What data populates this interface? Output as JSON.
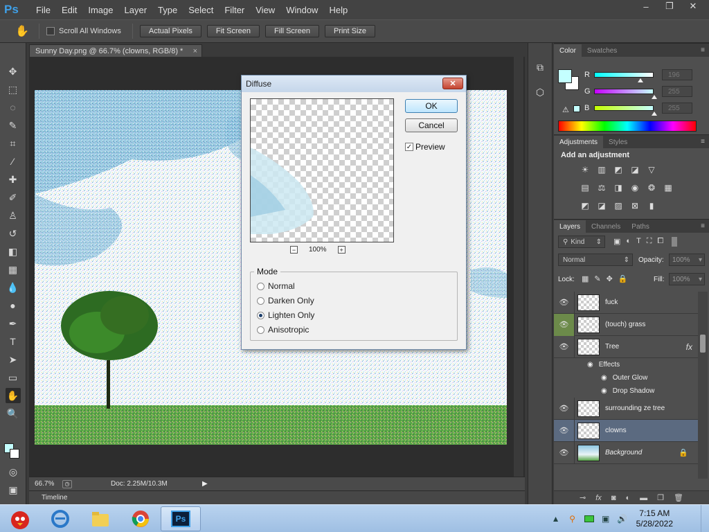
{
  "app": {
    "logo": "Ps",
    "menu": [
      "File",
      "Edit",
      "Image",
      "Layer",
      "Type",
      "Select",
      "Filter",
      "View",
      "Window",
      "Help"
    ],
    "window_controls": [
      "–",
      "❐",
      "✕"
    ]
  },
  "options_bar": {
    "scroll_all_label": "Scroll All Windows",
    "buttons": [
      "Actual Pixels",
      "Fit Screen",
      "Fill Screen",
      "Print Size"
    ]
  },
  "document": {
    "tab_title": "Sunny Day.png @ 66.7% (clowns, RGB/8) *",
    "tab_close": "×",
    "zoom": "66.7%",
    "doc_info": "Doc: 2.25M/10.3M",
    "timeline_label": "Timeline"
  },
  "color_panel": {
    "tabs": [
      "Color",
      "Swatches"
    ],
    "channels": [
      {
        "label": "R",
        "value": "196",
        "level": 0.77
      },
      {
        "label": "G",
        "value": "255",
        "level": 1.0
      },
      {
        "label": "B",
        "value": "255",
        "level": 1.0
      }
    ],
    "foreground": "#c4ffff"
  },
  "adjustments_panel": {
    "tabs": [
      "Adjustments",
      "Styles"
    ],
    "heading": "Add an adjustment"
  },
  "layers_panel": {
    "tabs": [
      "Layers",
      "Channels",
      "Paths"
    ],
    "kind_label": "Kind",
    "blend_mode": "Normal",
    "opacity_label": "Opacity:",
    "opacity_value": "100%",
    "lock_label": "Lock:",
    "fill_label": "Fill:",
    "fill_value": "100%",
    "fx_label": "fx",
    "layers": [
      {
        "name": "fuck"
      },
      {
        "name": "(touch) grass"
      },
      {
        "name": "Tree"
      },
      {
        "name": "surrounding ze tree"
      },
      {
        "name": "clowns"
      },
      {
        "name": "Background"
      }
    ],
    "effects_label": "Effects",
    "effects": [
      "Outer Glow",
      "Drop Shadow"
    ]
  },
  "dialog": {
    "title": "Diffuse",
    "ok_label": "OK",
    "cancel_label": "Cancel",
    "preview_label": "Preview",
    "zoom_value": "100%",
    "mode_label": "Mode",
    "modes": [
      "Normal",
      "Darken Only",
      "Lighten Only",
      "Anisotropic"
    ],
    "selected_mode": "Lighten Only"
  },
  "taskbar": {
    "time": "7:15 AM",
    "date": "5/28/2022"
  }
}
